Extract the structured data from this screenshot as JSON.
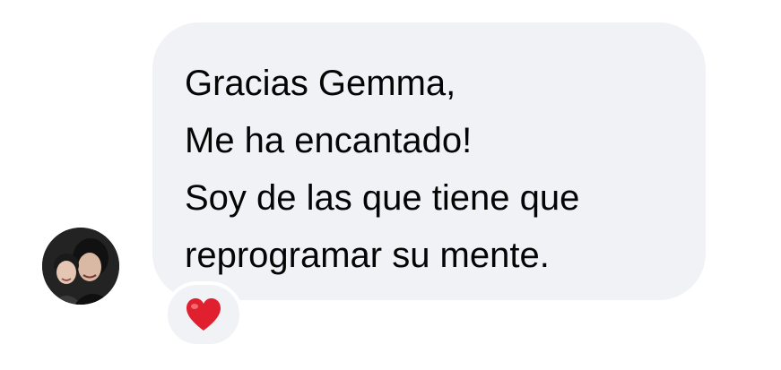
{
  "message": {
    "lines": [
      "Gracias Gemma,",
      "Me ha encantado!",
      "Soy de las que tiene que",
      "reprogramar su mente."
    ]
  },
  "reaction": {
    "icon": "heart-icon",
    "color": "#e0202e"
  },
  "avatar": {
    "icon": "profile-photo"
  },
  "colors": {
    "bubble": "#f1f2f5",
    "text": "#050505"
  }
}
